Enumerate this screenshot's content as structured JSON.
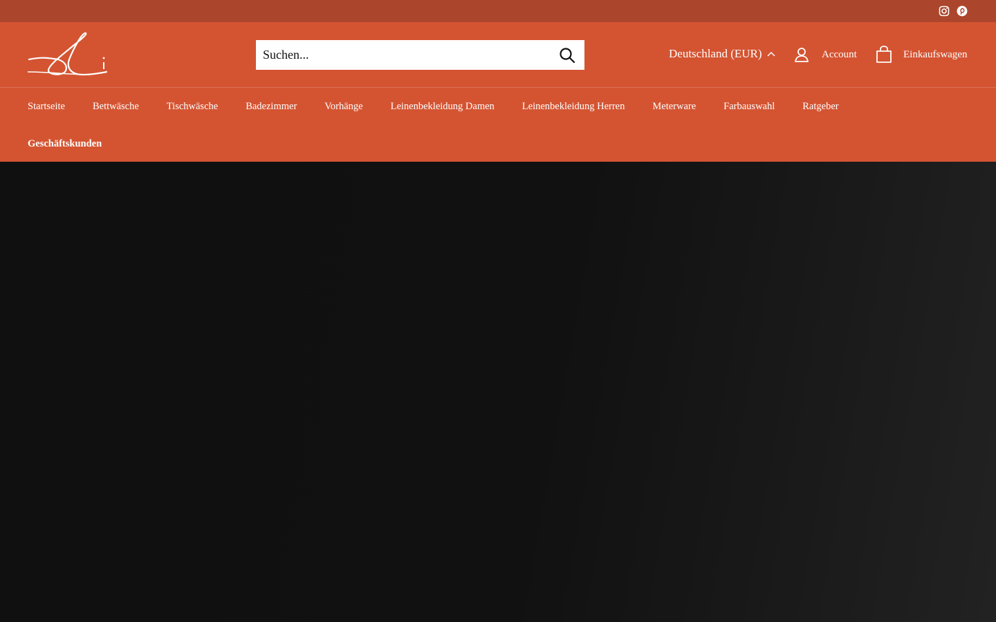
{
  "topbar": {
    "social": [
      {
        "icon": "instagram-icon",
        "label": "Instagram"
      },
      {
        "icon": "pinterest-icon",
        "label": "Pinterest"
      }
    ]
  },
  "header": {
    "search": {
      "placeholder": "Suchen..."
    },
    "locale": {
      "label": "Deutschland (EUR)"
    },
    "account": {
      "label": "Account"
    },
    "cart": {
      "label": "Einkaufswagen"
    }
  },
  "nav": {
    "row1": [
      "Startseite",
      "Bettwäsche",
      "Tischwäsche",
      "Badezimmer",
      "Vorhänge",
      "Leinenbekleidung Damen",
      "Leinenbekleidung Herren",
      "Meterware",
      "Farbauswahl",
      "Ratgeber"
    ],
    "row2": [
      "Geschäftskunden"
    ]
  },
  "colors": {
    "topbar": "#ab462c",
    "header": "#d45432",
    "hero": "#111111"
  }
}
